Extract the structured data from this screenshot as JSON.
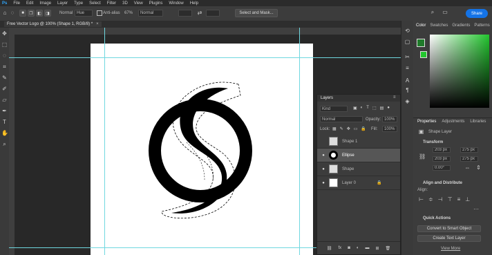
{
  "menu": {
    "items": [
      "File",
      "Edit",
      "Image",
      "Layer",
      "Type",
      "Select",
      "Filter",
      "3D",
      "View",
      "Plugins",
      "Window",
      "Help"
    ]
  },
  "options": {
    "mode_label": "Normal",
    "mode_value": "Hue",
    "antialias_label": "Anti-alias",
    "opacity_label": "67%",
    "style_value": "Normal",
    "select_mask_label": "Select and Mask...",
    "share_label": "Share"
  },
  "document": {
    "tab_title": "Free Vector Logo @ 100% (Shape 1, RGB/8) *"
  },
  "layers_panel": {
    "title": "Layers",
    "kind_filter": "Kind",
    "blend_mode": "Normal",
    "opacity_label": "Opacity:",
    "opacity_value": "100%",
    "lock_label": "Lock:",
    "fill_label": "Fill:",
    "fill_value": "100%",
    "layers": [
      {
        "name": "Shape 1",
        "visible": false
      },
      {
        "name": "Ellipse",
        "visible": true,
        "selected": true
      },
      {
        "name": "Shape",
        "visible": true
      },
      {
        "name": "Layer 0",
        "visible": true,
        "locked": true
      }
    ]
  },
  "color_panel": {
    "tabs": [
      "Color",
      "Swatches",
      "Gradients",
      "Patterns"
    ],
    "foreground": "#1f7a2a",
    "hue_accent": "#22c52e"
  },
  "properties_panel": {
    "tabs": [
      "Properties",
      "Adjustments",
      "Libraries"
    ],
    "layer_type": "Shape Layer",
    "transform_title": "Transform",
    "w_value": "203 px",
    "h_value": "203 px",
    "x_value": "275 px",
    "y_value": "275 px",
    "angle_value": "0.00°",
    "align_title": "Align and Distribute",
    "align_label": "Align:",
    "quick_title": "Quick Actions",
    "quick_actions": [
      "Convert to Smart Object",
      "Create Text Layer"
    ],
    "more_label": "View More"
  }
}
